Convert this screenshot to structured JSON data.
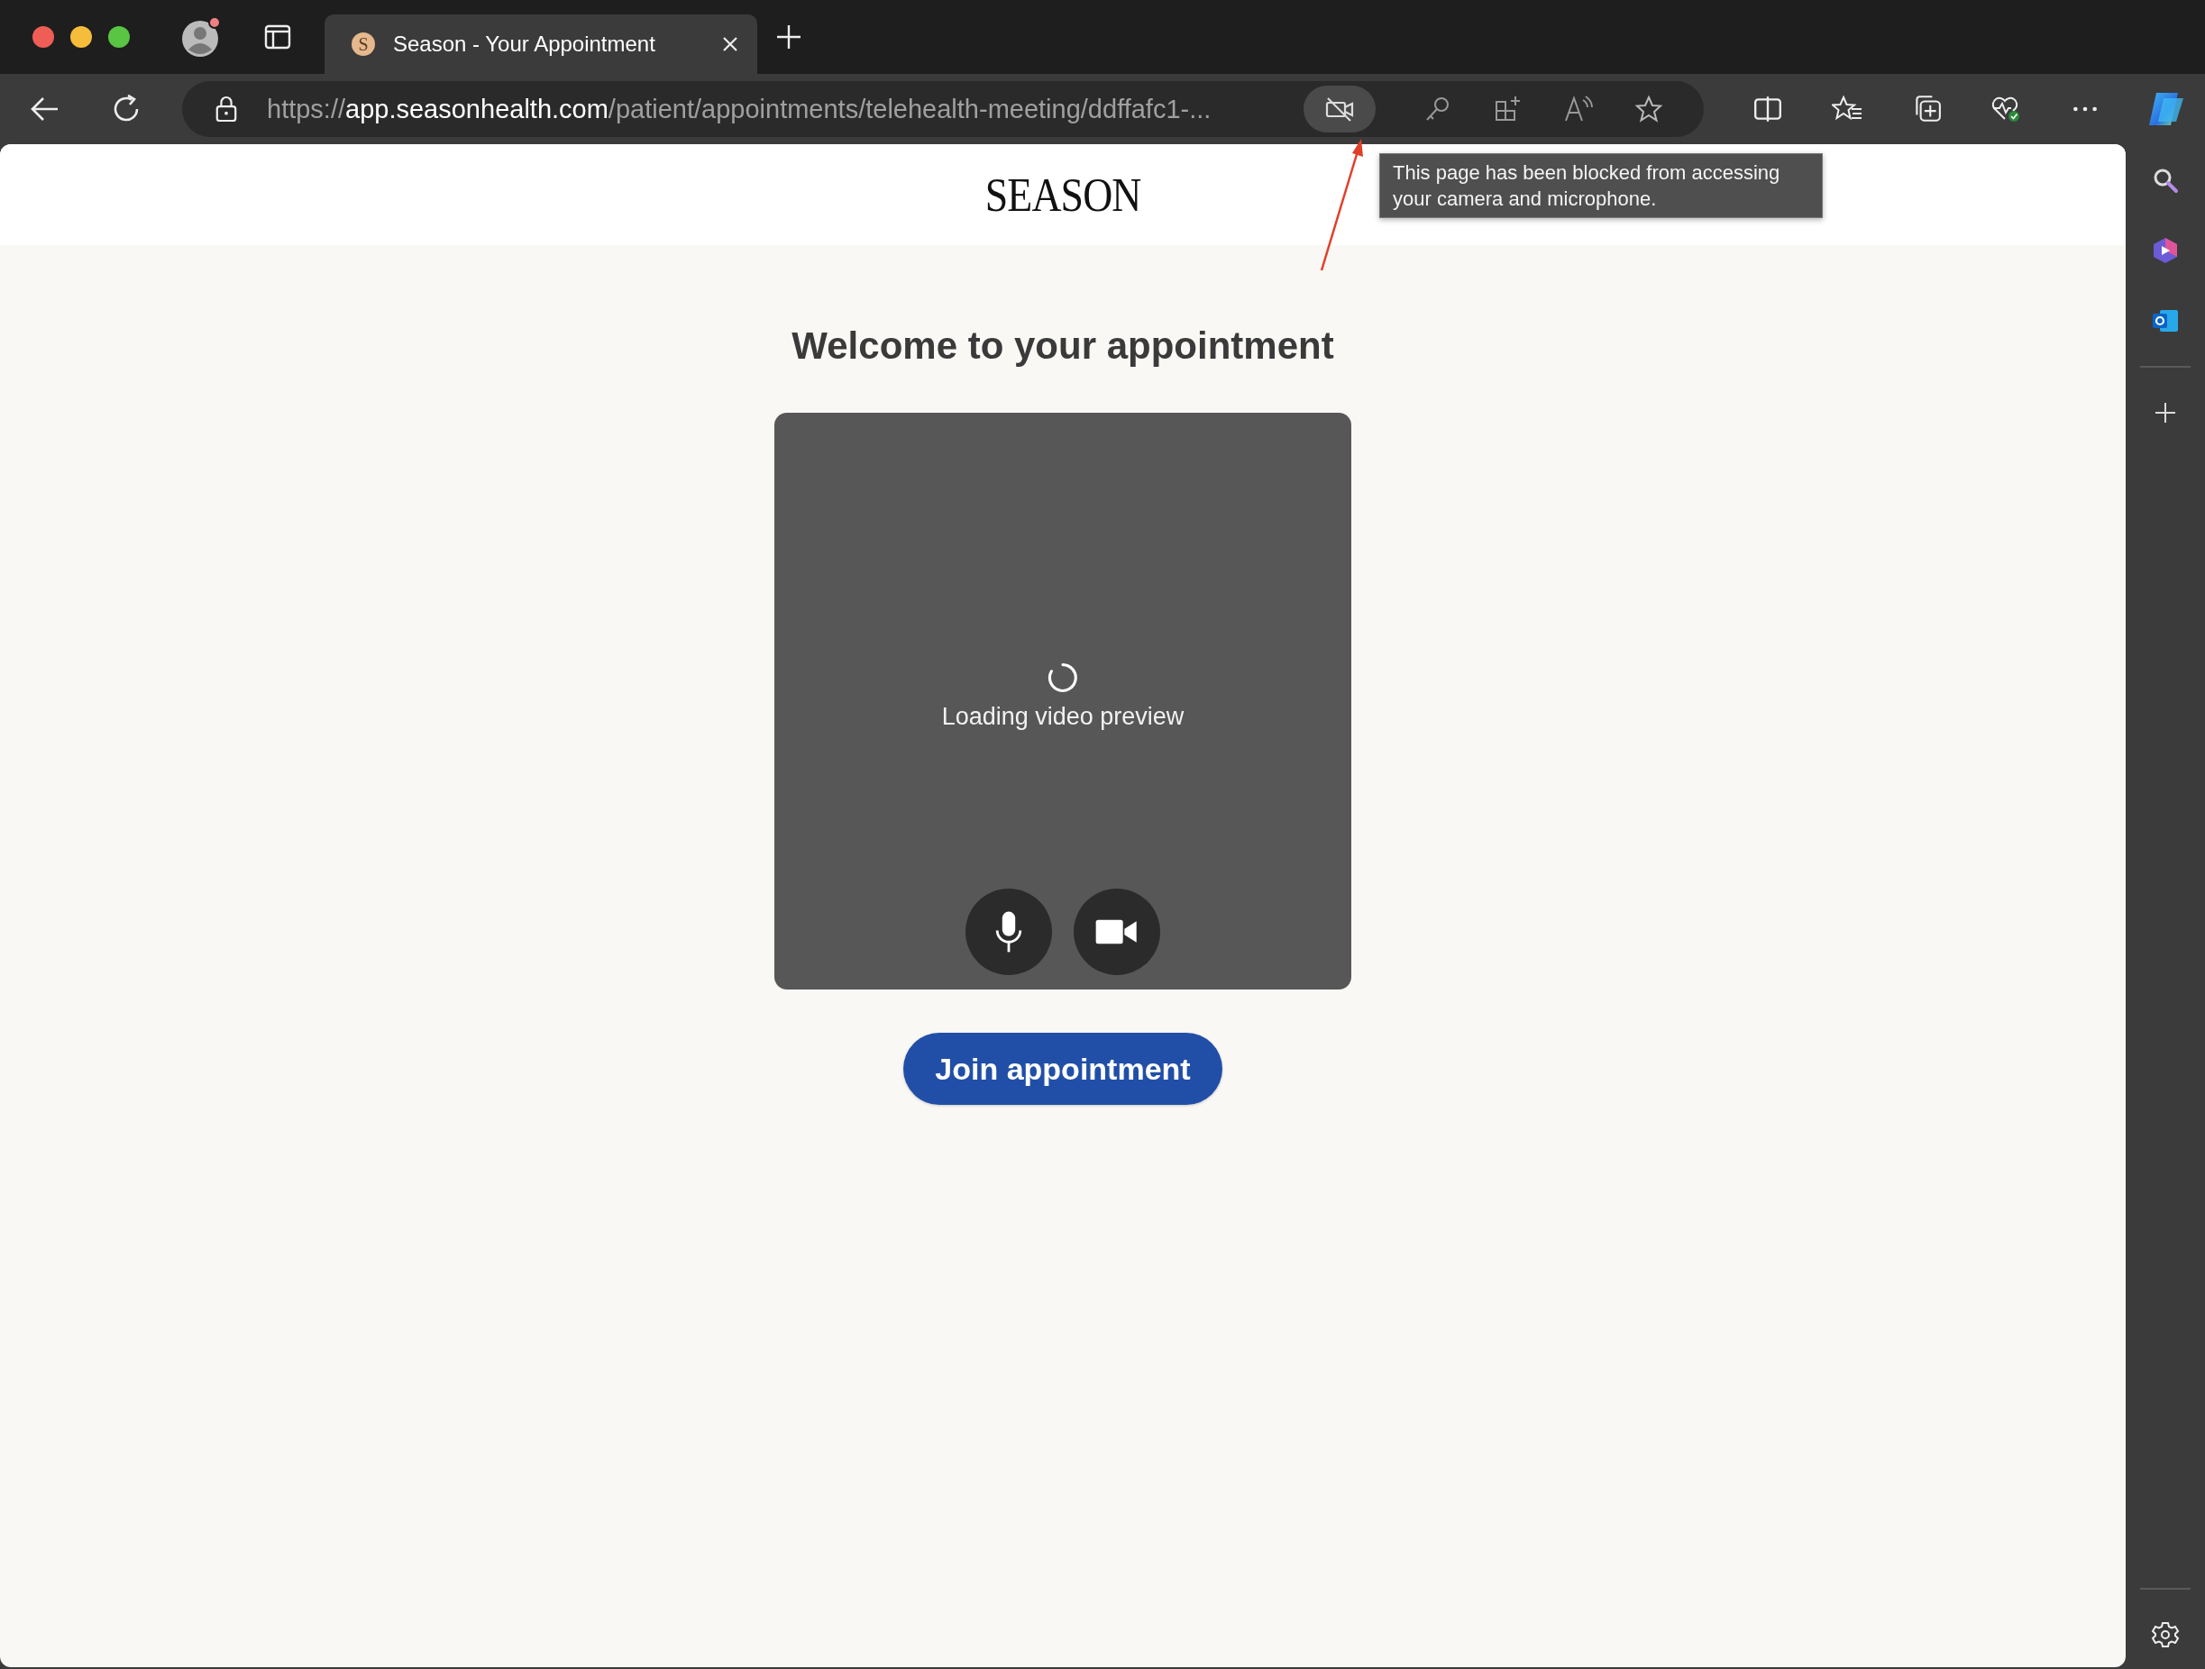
{
  "tabs": [
    {
      "favicon_letter": "S",
      "title": "Season - Your Appointment",
      "selected": true
    }
  ],
  "address_bar": {
    "scheme": "https://",
    "host": "app.seasonhealth.com",
    "path": "/patient/appointments/telehealth-meeting/ddffafc1-..."
  },
  "camera_blocked": true,
  "tooltip": "This page has been blocked from accessing your camera and microphone.",
  "page": {
    "logo": "SEASON",
    "heading": "Welcome to your appointment",
    "video_status": "Loading video preview",
    "join_button": "Join appointment"
  }
}
